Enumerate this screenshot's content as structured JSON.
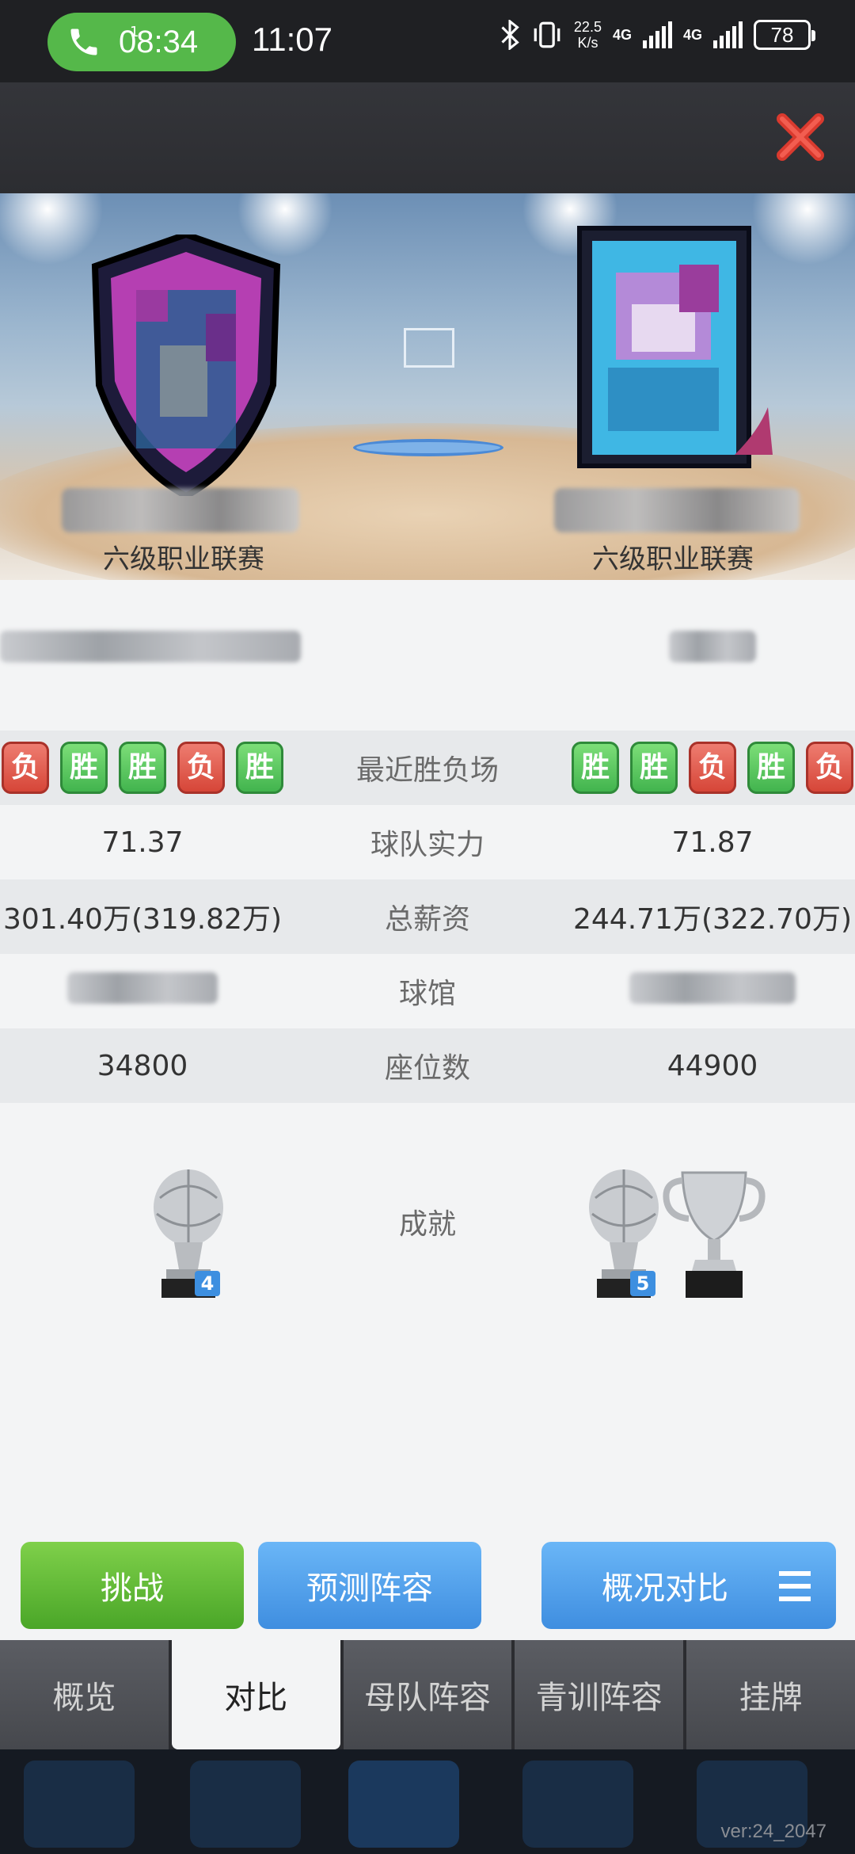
{
  "status_bar": {
    "call_time": "08:34",
    "call_badge": "1",
    "clock": "11:07",
    "net_speed_value": "22.5",
    "net_speed_unit": "K/s",
    "network_1": "4G",
    "network_2": "4G",
    "battery": "78"
  },
  "teams": {
    "left": {
      "league": "六级职业联赛"
    },
    "right": {
      "league": "六级职业联赛"
    }
  },
  "comparison": {
    "recent_label": "最近胜负场",
    "left_recent": [
      "负",
      "胜",
      "胜",
      "负",
      "胜"
    ],
    "right_recent": [
      "胜",
      "胜",
      "负",
      "胜",
      "负"
    ],
    "strength_label": "球队实力",
    "left_strength": "71.37",
    "right_strength": "71.87",
    "salary_label": "总薪资",
    "left_salary": "301.40万(319.82万)",
    "right_salary": "244.71万(322.70万)",
    "arena_label": "球馆",
    "seats_label": "座位数",
    "left_seats": "34800",
    "right_seats": "44900",
    "achievements_label": "成就",
    "left_trophy_count": "4",
    "right_trophy_count": "5"
  },
  "actions": {
    "challenge": "挑战",
    "predict_lineup": "预测阵容",
    "overview_compare": "概况对比"
  },
  "tabs": [
    {
      "label": "概览",
      "active": false
    },
    {
      "label": "对比",
      "active": true
    },
    {
      "label": "母队阵容",
      "active": false
    },
    {
      "label": "青训阵容",
      "active": false
    },
    {
      "label": "挂牌",
      "active": false
    }
  ],
  "version": "ver:24_2047",
  "colors": {
    "win": "#4fc159",
    "loss": "#dd4f42",
    "challenge": "#5ab83a",
    "primary_blue": "#4b9ae8"
  }
}
